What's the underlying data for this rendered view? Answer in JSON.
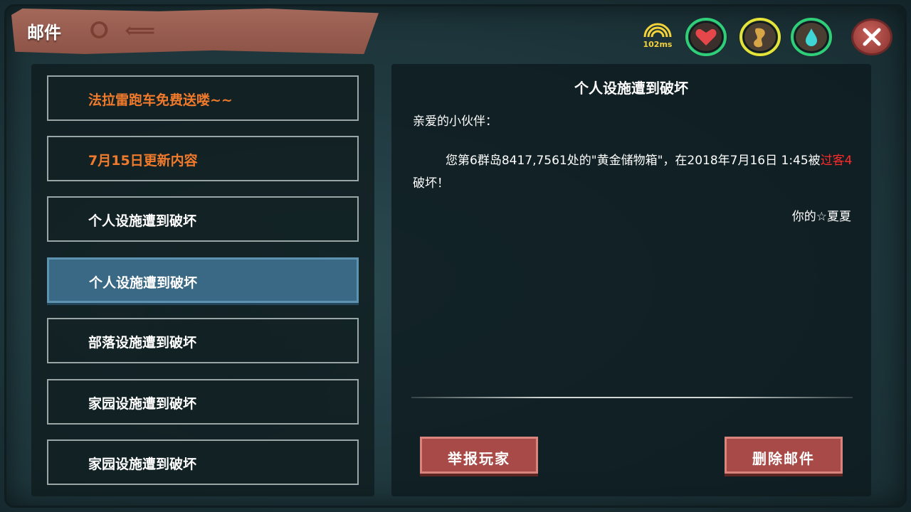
{
  "window": {
    "title": "邮件"
  },
  "status": {
    "ping": "102ms",
    "health_color": "#2fcf7a",
    "hunger_color": "#e3e33a",
    "water_color": "#2fcf7a"
  },
  "mail_list": [
    {
      "label": "法拉雷跑车免费送喽~~",
      "highlight": true
    },
    {
      "label": "7月15日更新内容",
      "highlight": true
    },
    {
      "label": "个人设施遭到破坏",
      "highlight": false
    },
    {
      "label": "个人设施遭到破坏",
      "highlight": false,
      "selected": true
    },
    {
      "label": "部落设施遭到破坏",
      "highlight": false
    },
    {
      "label": "家园设施遭到破坏",
      "highlight": false
    },
    {
      "label": "家园设施遭到破坏",
      "highlight": false
    }
  ],
  "mail": {
    "title": "个人设施遭到破坏",
    "greeting": "亲爱的小伙伴：",
    "body_prefix": "您第6群岛8417,7561处的\"黄金储物箱\"，在2018年7月16日 1:45被",
    "body_attacker": "过客4",
    "body_suffix": "破坏！",
    "signature": "你的☆夏夏"
  },
  "actions": {
    "report_label": "举报玩家",
    "delete_label": "删除邮件"
  },
  "colors": {
    "highlight_text": "#f07a2c",
    "attacker_text": "#ff2a2a",
    "selected_item": "#3a6985",
    "button": "#a84a47"
  }
}
